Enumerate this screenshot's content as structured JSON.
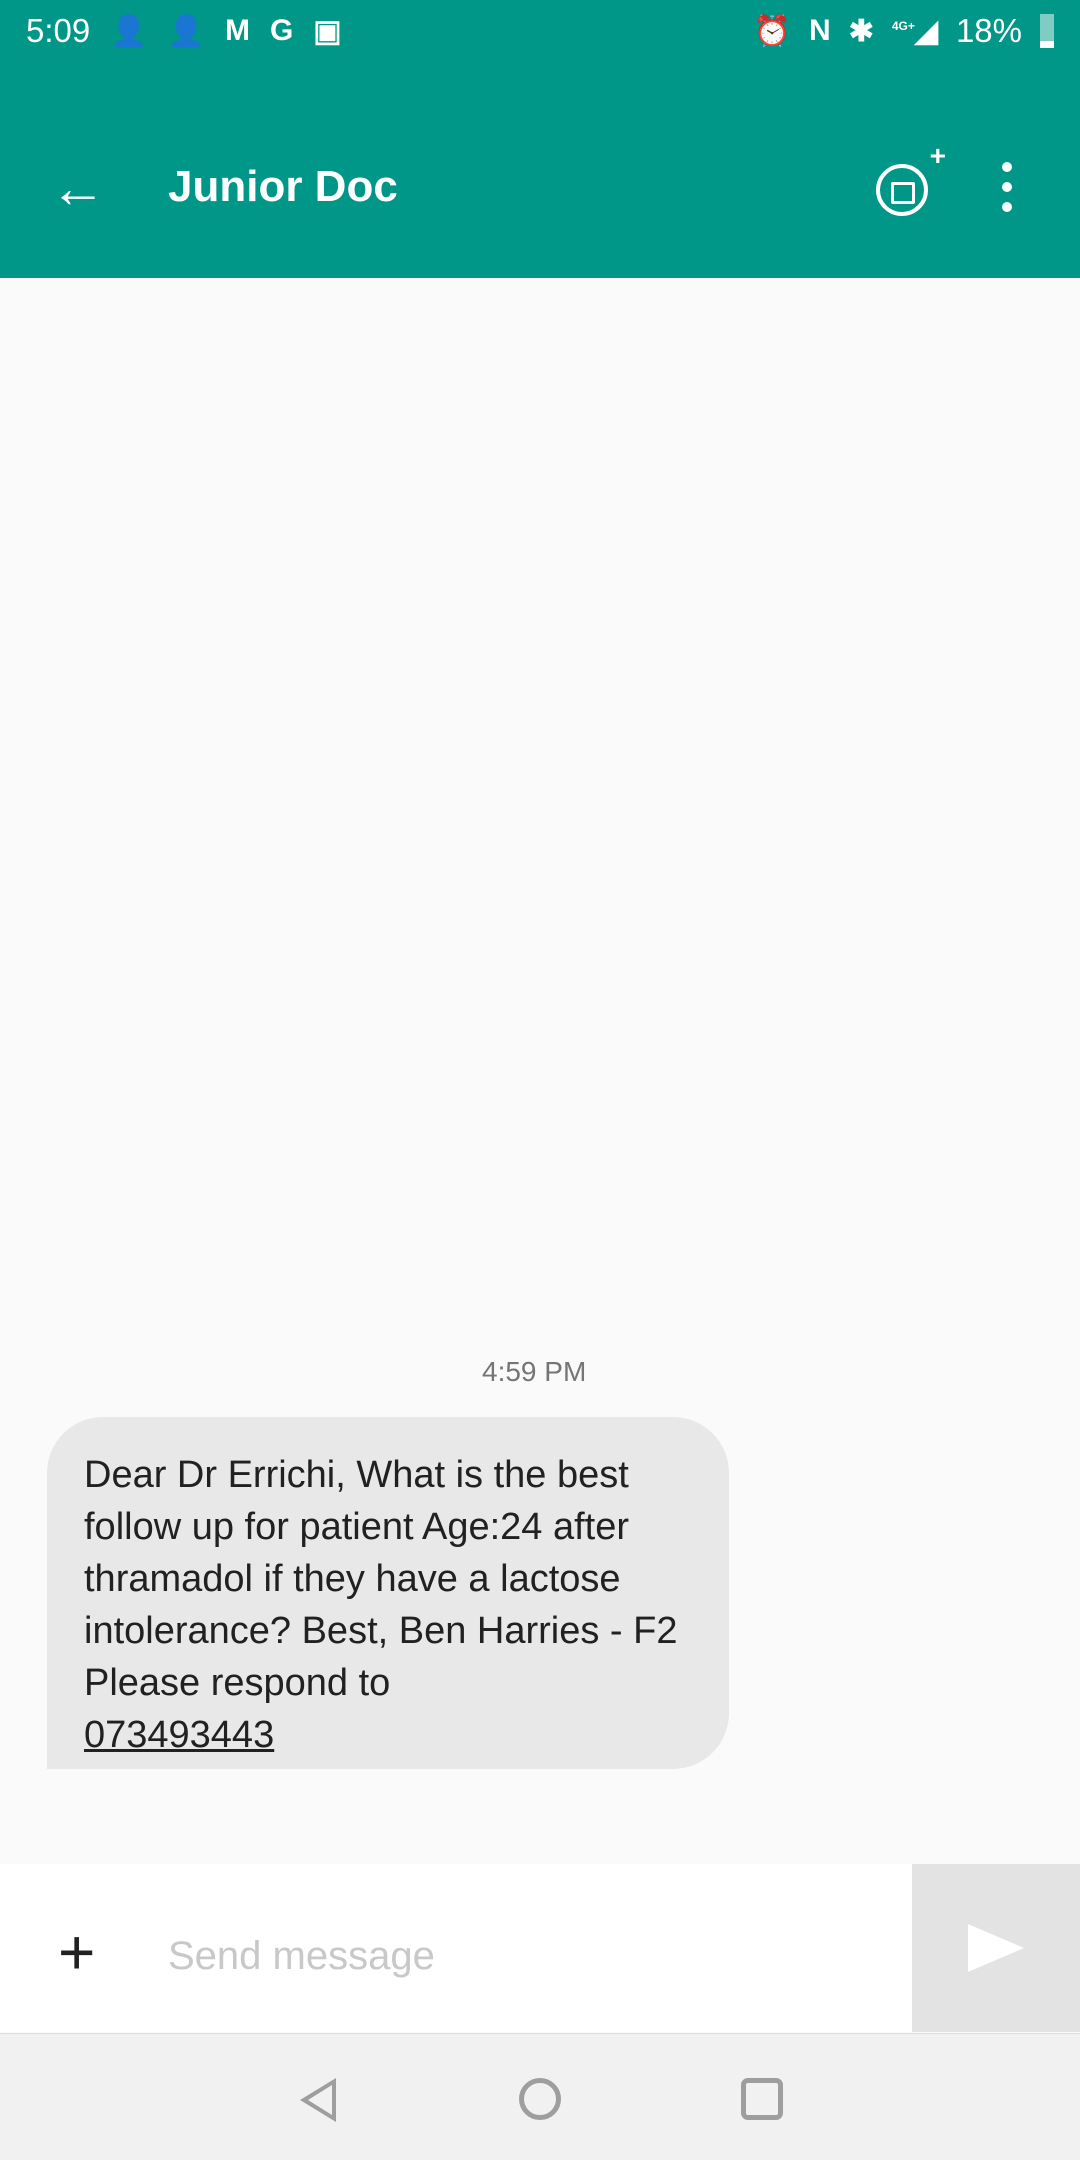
{
  "status_bar": {
    "time": "5:09",
    "left_icons": [
      "add-contact-icon",
      "add-contact-icon",
      "gmail-icon",
      "google-icon",
      "image-icon"
    ],
    "right_icons": [
      "alarm-icon",
      "nfc-icon",
      "bluetooth-icon",
      "signal-4g-plus-icon"
    ],
    "network": "4G+",
    "battery": "18%"
  },
  "header": {
    "title": "Junior Doc"
  },
  "conversation": {
    "timestamp": "4:59 PM",
    "message_text": "Dear Dr Errichi, What is the best follow up for patient Age:24 after thramadol if they have a lactose intolerance? Best, Ben Harries -  F2 Please respond to",
    "message_link": "073493443"
  },
  "composer": {
    "placeholder": "Send message"
  },
  "colors": {
    "primary": "#009688",
    "bubble": "#e8e8e8"
  }
}
